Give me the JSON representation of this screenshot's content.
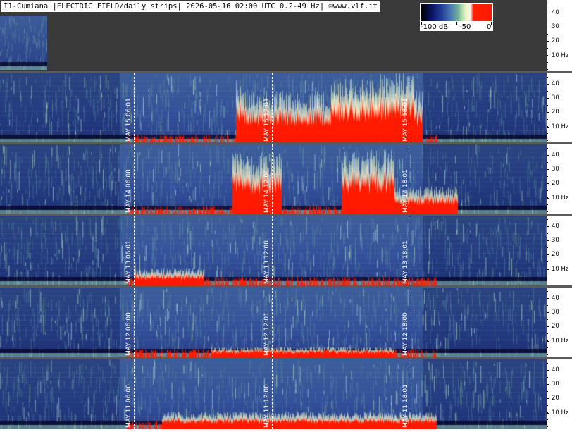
{
  "header": {
    "title": "I1-Cumiana |ELECTRIC FIELD/daily strips| 2026-05-16 02:00 UTC 0.2-49 Hz| ©www.vlf.it"
  },
  "legend": {
    "labels": [
      "-100 dB",
      "-50",
      "0"
    ],
    "scale_colors": [
      "#000000",
      "#1f3a96",
      "#6fae96",
      "#fbf7cf",
      "#ff1a00"
    ]
  },
  "axis": {
    "labels": [
      "40",
      "30",
      "20",
      "10 Hz"
    ]
  },
  "strips": [
    {
      "day": "MAY 15",
      "labels": [
        "MAY 15  06:01",
        "MAY 15  12:01",
        "MAY 15  18:01"
      ]
    },
    {
      "day": "MAY 14",
      "labels": [
        "MAY 14  06:00",
        "MAY 14  12:01",
        "MAY 14  18:01"
      ]
    },
    {
      "day": "MAY 13",
      "labels": [
        "MAY 13  06:01",
        "MAY 13  12:00",
        "MAY 13  18:01"
      ]
    },
    {
      "day": "MAY 12",
      "labels": [
        "MAY 12  06:00",
        "MAY 12  12:01",
        "MAY 12  18:00"
      ]
    },
    {
      "day": "MAY 11",
      "labels": [
        "MAY 11  06:00",
        "MAY 11  12:00",
        "MAY 11  18:01"
      ]
    }
  ],
  "colors": {
    "background_noise": "#2a3f8a",
    "storm_signal": "#ff1a00",
    "header_bg": "#3a3a3a"
  }
}
